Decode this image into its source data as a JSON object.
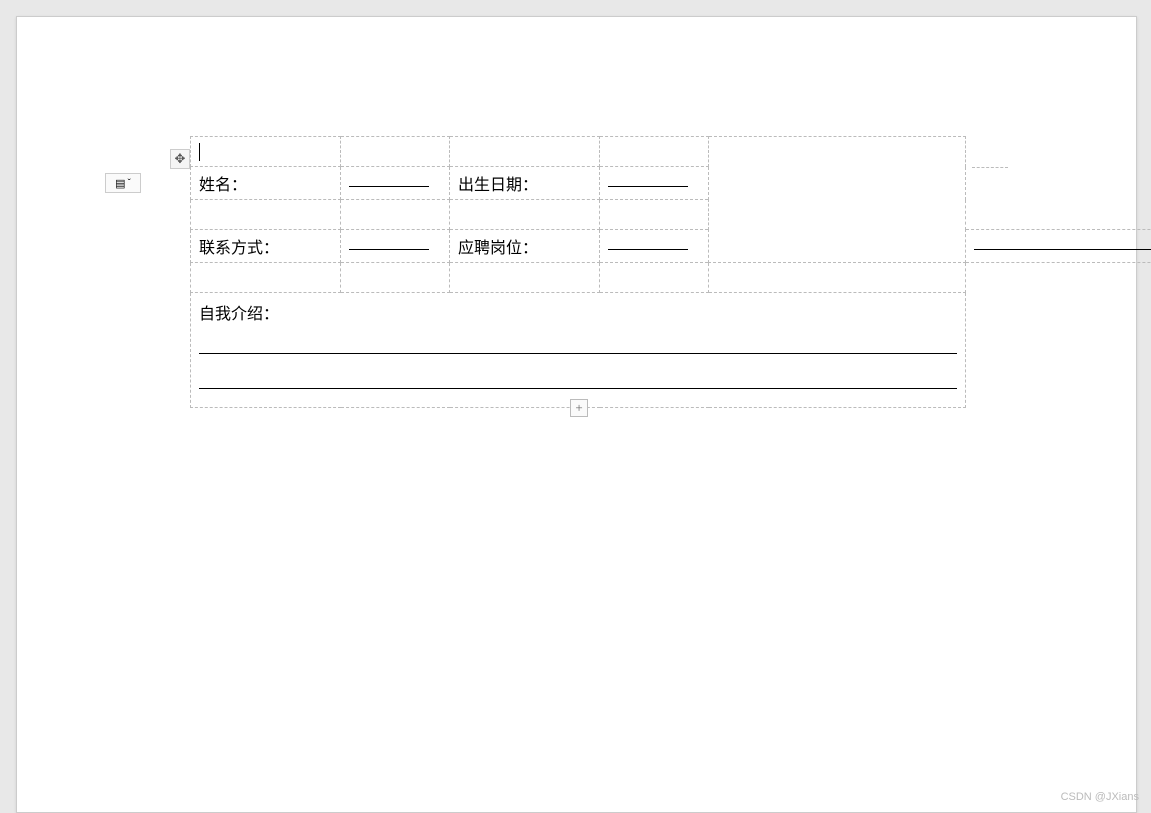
{
  "form": {
    "name_label": "姓名：",
    "dob_label": "出生日期：",
    "contact_label": "联系方式：",
    "position_label": "应聘岗位：",
    "intro_label": "自我介绍："
  },
  "controls": {
    "add": "+",
    "resize": "↘"
  },
  "watermark": "CSDN @JXians"
}
